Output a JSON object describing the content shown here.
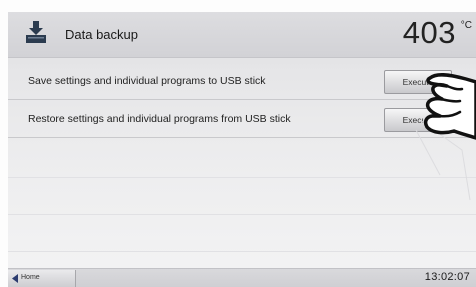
{
  "header": {
    "title": "Data backup",
    "icon": "usb-download-icon",
    "temperature": "403",
    "temperature_unit": "°C"
  },
  "rows": [
    {
      "label": "Save settings and individual programs to USB stick",
      "button_label": "Execute"
    },
    {
      "label": "Restore settings and individual programs from USB stick",
      "button_label": "Execute"
    }
  ],
  "footer": {
    "home_label": "Home",
    "time": "13:02:07"
  },
  "colors": {
    "screen_background": "#e6e6e8",
    "button": "#d8d8db"
  }
}
